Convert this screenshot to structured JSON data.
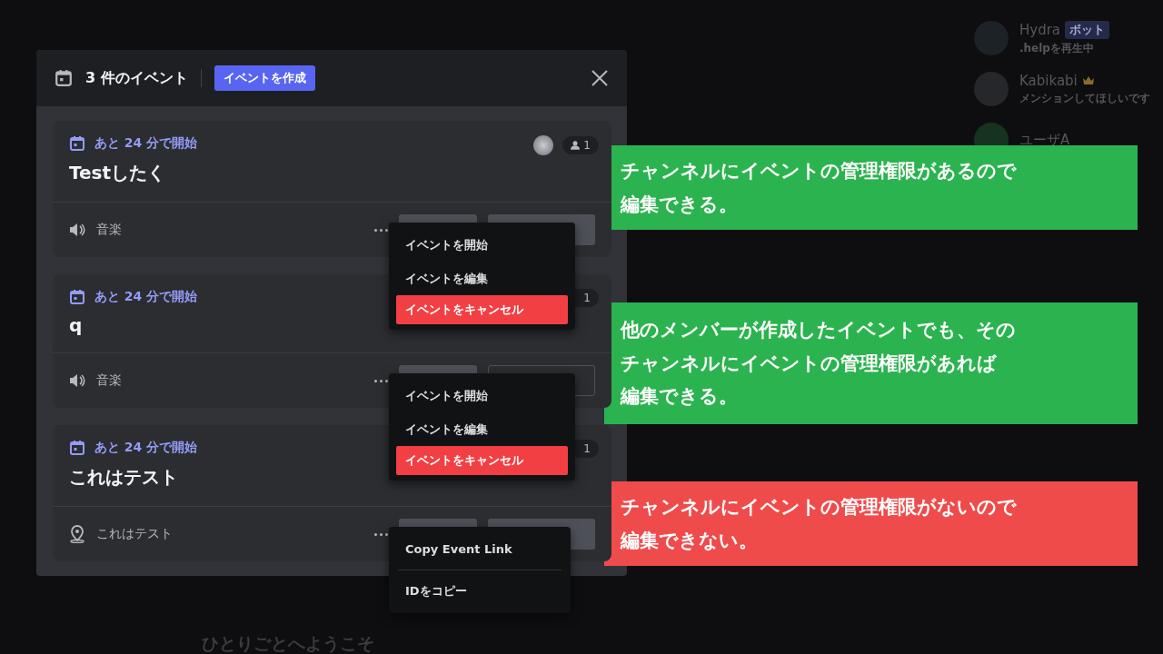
{
  "modal": {
    "title": "3 件のイベント",
    "create_button": "イベントを作成"
  },
  "events": [
    {
      "status": "あと 24 分で開始",
      "title": "Testしたく",
      "location": {
        "kind": "voice",
        "name": "音楽"
      },
      "avatar": true,
      "attendee_icon": true,
      "attendees": "1",
      "buttons": [
        {
          "kind": "filled"
        },
        {
          "kind": "filled"
        }
      ],
      "menu": [
        {
          "kind": "item",
          "label": "イベントを開始"
        },
        {
          "kind": "item",
          "label": "イベントを編集"
        },
        {
          "kind": "danger",
          "label": "イベントをキャンセル"
        }
      ]
    },
    {
      "status": "あと 24 分で開始",
      "title": "q",
      "location": {
        "kind": "voice",
        "name": "音楽"
      },
      "avatar": false,
      "attendees": "1",
      "buttons": [
        {
          "kind": "filled"
        },
        {
          "kind": "outline"
        }
      ],
      "menu": [
        {
          "kind": "item",
          "label": "イベントを開始"
        },
        {
          "kind": "item",
          "label": "イベントを編集"
        },
        {
          "kind": "danger",
          "label": "イベントをキャンセル"
        }
      ]
    },
    {
      "status": "あと 24 分で開始",
      "title": "これはテスト",
      "location": {
        "kind": "place",
        "name": "これはテスト"
      },
      "avatar": false,
      "attendees": "1",
      "buttons": [
        {
          "kind": "filled"
        },
        {
          "kind": "filled"
        }
      ],
      "menu": [
        {
          "kind": "item",
          "label": "Copy Event Link"
        },
        {
          "kind": "divider"
        },
        {
          "kind": "item",
          "label": "IDをコピー"
        }
      ]
    }
  ],
  "annotations": [
    {
      "lines": [
        "チャンネルにイベントの管理権限があるので",
        "編集できる。"
      ],
      "color": "#2bb34f"
    },
    {
      "lines": [
        "他のメンバーが作成したイベントでも、その",
        "チャンネルにイベントの管理権限があれば",
        "編集できる。"
      ],
      "color": "#2bb34f"
    },
    {
      "lines": [
        "チャンネルにイベントの管理権限がないので",
        "編集できない。"
      ],
      "color": "#f04b4b"
    }
  ],
  "members": [
    {
      "name": "Hydra",
      "badge": "ボット",
      "activity": ".helpを再生中"
    },
    {
      "name": "Kabikabi",
      "activity": "メンションしてほしいです",
      "crown": true
    },
    {
      "name": "ユーザA"
    }
  ],
  "welcome": "ひとりごとへようこそ"
}
